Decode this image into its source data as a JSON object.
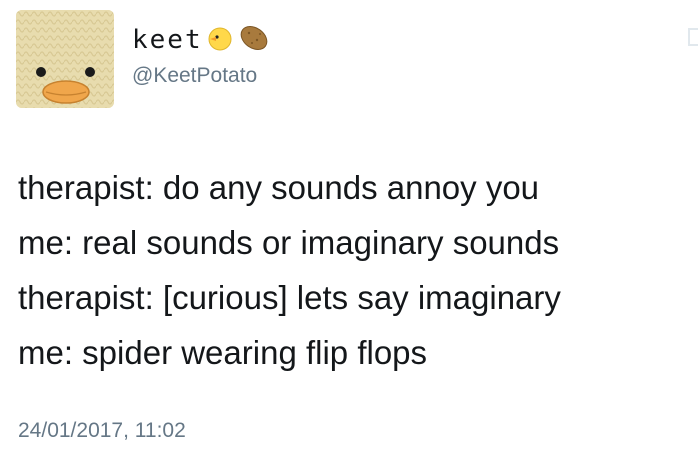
{
  "user": {
    "display_name": "keet",
    "handle": "@KeetPotato",
    "name_emojis": [
      "baby-chick-icon",
      "potato-icon"
    ]
  },
  "tweet": {
    "lines": [
      "therapist: do any sounds annoy you",
      "me: real sounds or imaginary sounds",
      "therapist: [curious] lets say imaginary",
      "me: spider wearing flip flops"
    ],
    "timestamp": "24/01/2017, 11:02"
  },
  "colors": {
    "text": "#14171a",
    "secondary": "#657786",
    "avatar_bg": "#e9ddb0",
    "beak": "#f0a64b"
  }
}
